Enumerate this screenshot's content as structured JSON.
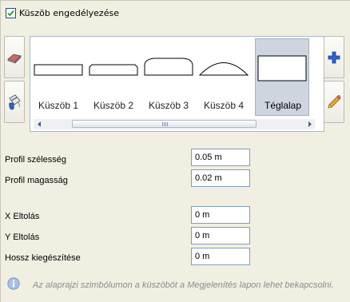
{
  "threshold": {
    "enable_label": "Küszöb engedélyezése",
    "enabled": true
  },
  "profiles": {
    "items": [
      {
        "label": "Küszöb 1",
        "icon": "threshold-1-flat-icon"
      },
      {
        "label": "Küszöb 2",
        "icon": "threshold-2-beveled-icon"
      },
      {
        "label": "Küszöb 3",
        "icon": "threshold-3-rounded-icon"
      },
      {
        "label": "Küszöb 4",
        "icon": "threshold-4-arc-icon"
      },
      {
        "label": "Téglalap",
        "icon": "rectangle-icon"
      }
    ],
    "selected_index": 4,
    "side_buttons": {
      "left_top": "eraser-icon",
      "left_bottom": "paint-bucket-icon",
      "right_top": "add-plus-icon",
      "right_bottom": "pencil-icon"
    }
  },
  "fields": {
    "profile_width": {
      "label": "Profil szélesség",
      "value": "0.05 m"
    },
    "profile_height": {
      "label": "Profil magasság",
      "value": "0.02 m"
    },
    "x_offset": {
      "label": "X Eltolás",
      "value": "0 m"
    },
    "y_offset": {
      "label": "Y Eltolás",
      "value": "0 m"
    },
    "length_extension": {
      "label": "Hossz kiegészítése",
      "value": "0 m"
    }
  },
  "info": {
    "icon": "info-icon",
    "text": "Az alaprajzi szimbólumon a küszöböt a Megjelenítés lapon lehet bekapcsolni."
  }
}
